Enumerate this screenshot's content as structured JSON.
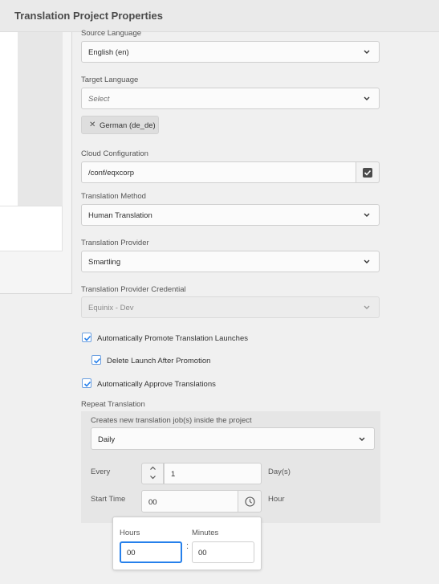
{
  "header": {
    "title": "Translation Project Properties"
  },
  "form": {
    "source_language": {
      "label": "Source Language",
      "value": "English (en)"
    },
    "target_language": {
      "label": "Target Language",
      "placeholder": "Select",
      "tags": [
        "German (de_de)"
      ]
    },
    "cloud_configuration": {
      "label": "Cloud Configuration",
      "value": "/conf/eqxcorp"
    },
    "translation_method": {
      "label": "Translation Method",
      "value": "Human Translation"
    },
    "translation_provider": {
      "label": "Translation Provider",
      "value": "Smartling"
    },
    "provider_credential": {
      "label": "Translation Provider Credential",
      "value": "Equinix - Dev"
    },
    "checkboxes": {
      "auto_promote": {
        "label": "Automatically Promote Translation Launches",
        "checked": true
      },
      "delete_launch": {
        "label": "Delete Launch After Promotion",
        "checked": true
      },
      "auto_approve": {
        "label": "Automatically Approve Translations",
        "checked": true
      }
    },
    "repeat_translation": {
      "label": "Repeat Translation",
      "sub_label": "Creates new translation job(s) inside the project",
      "frequency": "Daily",
      "every_label": "Every",
      "every_value": "1",
      "every_unit": "Day(s)",
      "start_time_label": "Start Time",
      "start_time_value": "00",
      "start_time_unit": "Hour"
    },
    "time_picker": {
      "hours_label": "Hours",
      "hours_value": "00",
      "separator": ":",
      "minutes_label": "Minutes",
      "minutes_value": "00"
    }
  },
  "colors": {
    "accent": "#2680eb",
    "header_bg": "#eaeaea",
    "page_bg": "#f0f0f0"
  }
}
